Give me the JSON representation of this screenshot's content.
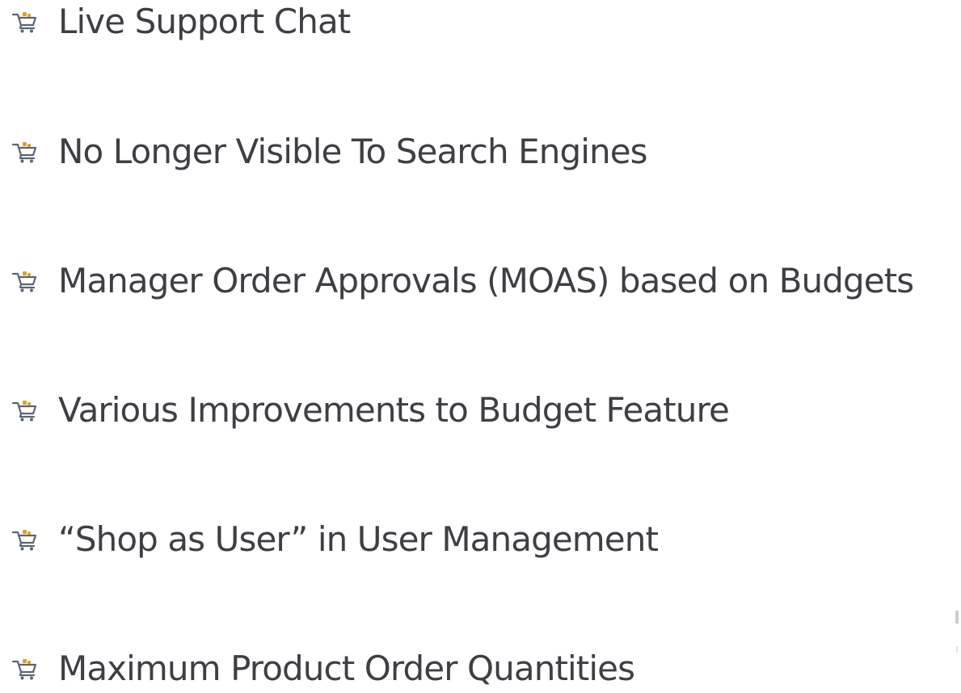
{
  "features": {
    "icon": "shopping-cart-icon",
    "accent_color": "#e2a021",
    "icon_color": "#5b6478",
    "text_color": "#3d3f45",
    "items": [
      {
        "label": "Live Support Chat"
      },
      {
        "label": "No Longer Visible To Search Engines"
      },
      {
        "label": "Manager Order Approvals (MOAS) based on Budgets"
      },
      {
        "label": "Various Improvements to Budget Feature"
      },
      {
        "label": "“Shop as User” in User Management"
      },
      {
        "label": "Maximum Product Order Quantities"
      }
    ]
  }
}
